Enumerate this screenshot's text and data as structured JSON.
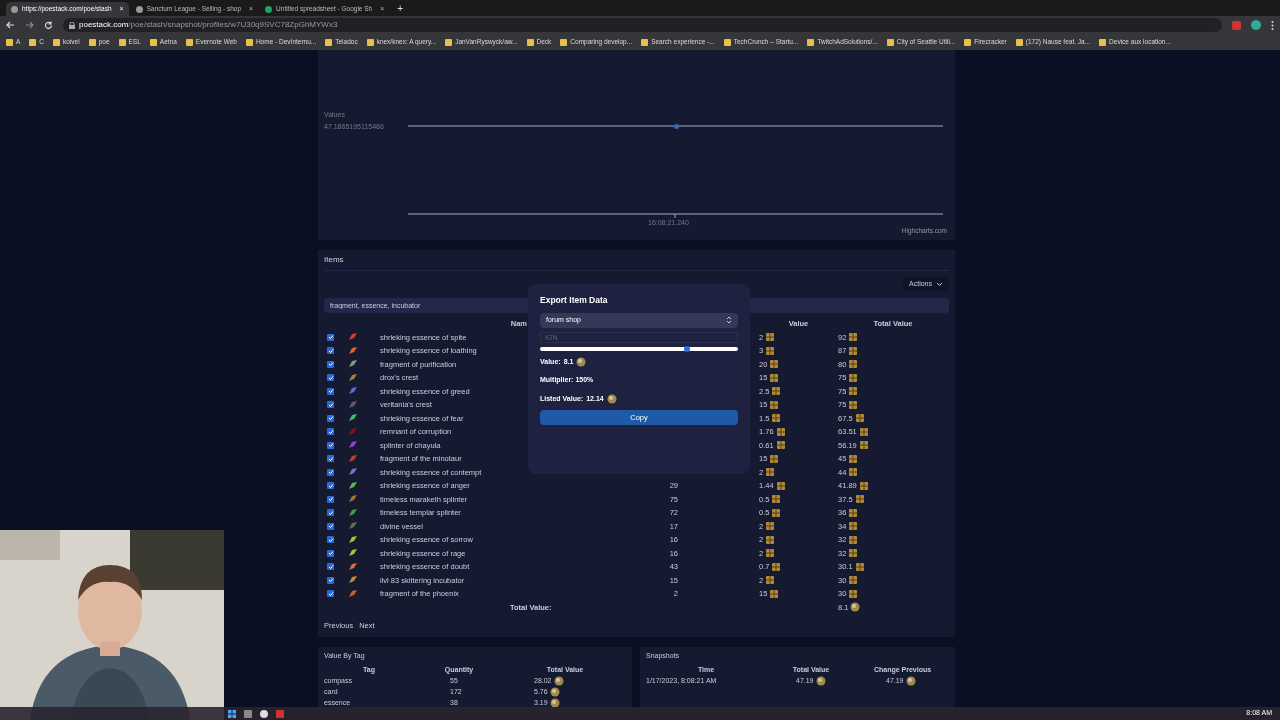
{
  "browser": {
    "tabs": [
      {
        "title": "https://poestack.com/poe/stash",
        "selected": true
      },
      {
        "title": "Sanctum League - Selling - shop",
        "selected": false
      },
      {
        "title": "Untitled spreadsheet - Google Sh",
        "selected": false
      }
    ],
    "url": {
      "host": "poestack.com",
      "path": "/poe/stash/snapshot/profiles/w7U30q9SVC78ZpGhMYWx3"
    },
    "bookmarks": [
      "A",
      "C",
      "koivel",
      "poe",
      "ESL",
      "Aetna",
      "Evernote Web",
      "Home - DevInternu...",
      "Teladoc",
      "knex/knex: A query...",
      "JanVanRyswyck/aw...",
      "Deck",
      "Comparing develop...",
      "Search experience -...",
      "TechCrunch – Startu...",
      "TwitchAdSolutions/...",
      "City of Seattle Utili...",
      "Firecracker",
      "(172) Nause feat. Ja...",
      "Device aux location..."
    ]
  },
  "chart": {
    "y_title": "Values",
    "y_tick": "47.1865195115486",
    "x_tick": "16:08:21.240",
    "credit": "Highcharts.com"
  },
  "items": {
    "title": "Items",
    "actions": "Actions",
    "filter": "fragment, essence, incubator",
    "columns": {
      "name": "Nam",
      "value": "Value",
      "total": "Total Value"
    },
    "rows": [
      {
        "checked": true,
        "color": "#d83a3a",
        "name": "shrieking essence of spite",
        "value": "2",
        "total": "92"
      },
      {
        "checked": true,
        "color": "#e0603a",
        "name": "shrieking essence of loathing",
        "value": "3",
        "total": "87"
      },
      {
        "checked": true,
        "color": "#8a9a7a",
        "name": "fragment of purification",
        "value": "20",
        "total": "80"
      },
      {
        "checked": true,
        "color": "#b07a30",
        "name": "drox's crest",
        "value": "15",
        "total": "75"
      },
      {
        "checked": true,
        "color": "#5a6ad8",
        "name": "shrieking essence of greed",
        "value": "2.5",
        "total": "75"
      },
      {
        "checked": true,
        "color": "#5a6070",
        "name": "veritania's crest",
        "value": "15",
        "total": "75"
      },
      {
        "checked": true,
        "color": "#3ac060",
        "name": "shrieking essence of fear",
        "value": "1.5",
        "total": "67.5"
      },
      {
        "checked": true,
        "color": "#8a1020",
        "name": "remnant of corruption",
        "value": "1.76",
        "total": "63.51"
      },
      {
        "checked": true,
        "color": "#9a40d0",
        "name": "splinter of chayula",
        "value": "0.61",
        "total": "56.19"
      },
      {
        "checked": true,
        "color": "#c04030",
        "name": "fragment of the minotaur",
        "value": "15",
        "total": "45"
      },
      {
        "checked": true,
        "color": "#7a70d0",
        "name": "shrieking essence of contempt",
        "value": "2",
        "total": "44"
      },
      {
        "checked": true,
        "color": "#50c050",
        "name": "shrieking essence of anger",
        "quantity": "29",
        "value": "1.44",
        "total": "41.89"
      },
      {
        "checked": true,
        "color": "#a07040",
        "name": "timeless maraketh splinter",
        "quantity": "75",
        "value": "0.5",
        "total": "37.5"
      },
      {
        "checked": true,
        "color": "#40a040",
        "name": "timeless templar splinter",
        "quantity": "72",
        "value": "0.5",
        "total": "36"
      },
      {
        "checked": true,
        "color": "#607040",
        "name": "divine vessel",
        "quantity": "17",
        "value": "2",
        "total": "34"
      },
      {
        "checked": true,
        "color": "#a0c040",
        "name": "shrieking essence of sorrow",
        "quantity": "16",
        "value": "2",
        "total": "32"
      },
      {
        "checked": true,
        "color": "#b0c030",
        "name": "shrieking essence of rage",
        "quantity": "16",
        "value": "2",
        "total": "32"
      },
      {
        "checked": true,
        "color": "#d07040",
        "name": "shrieking essence of doubt",
        "quantity": "43",
        "value": "0.7",
        "total": "30.1"
      },
      {
        "checked": true,
        "color": "#c09020",
        "name": "ilvl 83 skittering incubator",
        "quantity": "15",
        "value": "2",
        "total": "30"
      },
      {
        "checked": true,
        "color": "#d06020",
        "name": "fragment of the phoenix",
        "quantity": "2",
        "value": "15",
        "total": "30"
      }
    ],
    "total_label": "Total Value:",
    "total": "8.1",
    "pager": [
      "Previous",
      "Next"
    ]
  },
  "export": {
    "title": "Export Item Data",
    "format": "forum shop",
    "ign_placeholder": "IGN",
    "multiplier_slider": {
      "level": 0.74
    },
    "value_label": "Value:",
    "value": "8.1",
    "multiplier": "Multiplier: 150%",
    "listed_label": "Listed Value:",
    "listed": "12.14",
    "button": "Copy"
  },
  "value_by_tag": {
    "title": "Value By Tag",
    "columns": [
      "Tag",
      "Quantity",
      "Total Value"
    ],
    "rows": [
      [
        "compass",
        "55",
        "28.02"
      ],
      [
        "card",
        "172",
        "5.76"
      ],
      [
        "essence",
        "38",
        "3.19"
      ]
    ]
  },
  "snapshots": {
    "title": "Snapshots",
    "columns": [
      "Time",
      "Total Value",
      "Change Previous"
    ],
    "rows": [
      [
        "1/17/2023, 8:08:21 AM",
        "47.19",
        "47.19"
      ]
    ]
  },
  "taskbar": {
    "clock": "8:08 AM"
  },
  "tab_close": "×",
  "new_tab": "+"
}
